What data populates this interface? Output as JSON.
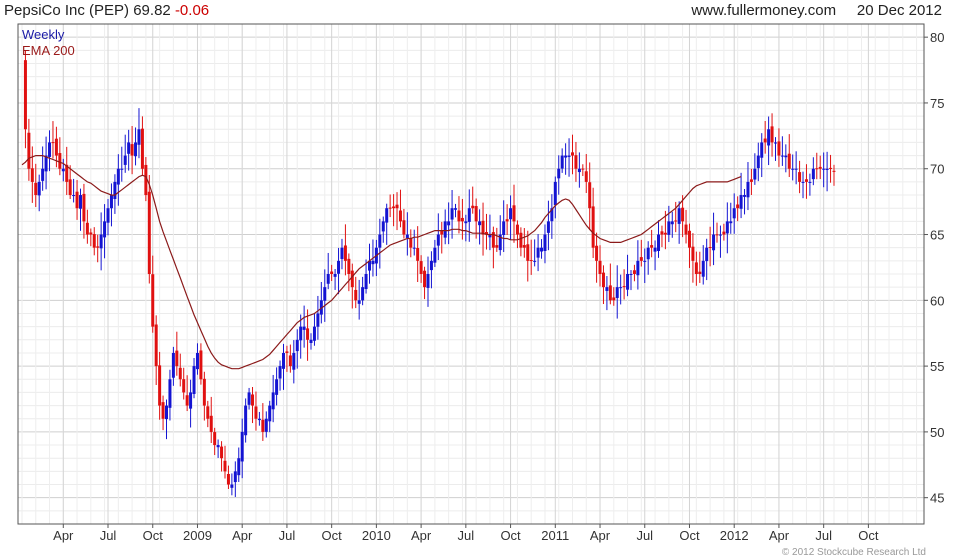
{
  "header": {
    "title": "PepsiCo Inc (PEP)",
    "last": "69.82",
    "change": "-0.06",
    "site": "www.fullermoney.com",
    "date": "20 Dec 2012"
  },
  "legend": {
    "weekly": "Weekly",
    "ema": "EMA 200"
  },
  "copyright": "© 2012 Stockcube Research Ltd",
  "colors": {
    "up": "#1414d2",
    "down": "#e01010",
    "ema": "#8b1a1a",
    "grid": "#dddddd",
    "frame": "#555555"
  },
  "chart_data": {
    "type": "candlestick",
    "period": "Weekly",
    "ylim": [
      43,
      81
    ],
    "y_ticks": [
      45,
      50,
      55,
      60,
      65,
      70,
      75,
      80
    ],
    "x_ticks": [
      "Apr",
      "Jul",
      "Oct",
      "2009",
      "Apr",
      "Jul",
      "Oct",
      "2010",
      "Apr",
      "Jul",
      "Oct",
      "2011",
      "Apr",
      "Jul",
      "Oct",
      "2012",
      "Apr",
      "Jul",
      "Oct"
    ],
    "x_tick_index": [
      12,
      25,
      38,
      51,
      64,
      77,
      90,
      103,
      116,
      129,
      142,
      155,
      168,
      181,
      194,
      207,
      220,
      233,
      246
    ],
    "x_range": [
      0,
      261
    ],
    "close_series": [
      78,
      73,
      70,
      69,
      68,
      69,
      70,
      71,
      72,
      72,
      71,
      70,
      70,
      69,
      68,
      68,
      67,
      68,
      66,
      65,
      65,
      64,
      64,
      65,
      66,
      67,
      68,
      69,
      70,
      70,
      71,
      72,
      71,
      72,
      73,
      70,
      68,
      62,
      58,
      55,
      52,
      51,
      52,
      54,
      56,
      55,
      54,
      53,
      52,
      53,
      55,
      56,
      54,
      52,
      51,
      50,
      49,
      49,
      48,
      47,
      46,
      46,
      47,
      48,
      50,
      52,
      53,
      52,
      51,
      51,
      50,
      51,
      52,
      53,
      54,
      55,
      56,
      56,
      55,
      56,
      57,
      58,
      58,
      57,
      57,
      58,
      59,
      60,
      61,
      62,
      62,
      62,
      63,
      64,
      63,
      62,
      61,
      60,
      60,
      61,
      62,
      63,
      63,
      64,
      65,
      66,
      67,
      67,
      67,
      67,
      66,
      65,
      65,
      64,
      64,
      63,
      62,
      61,
      62,
      63,
      64,
      65,
      65,
      66,
      66,
      67,
      67,
      66,
      66,
      66,
      67,
      67,
      66,
      66,
      65,
      65,
      65,
      64,
      64,
      65,
      66,
      66,
      67,
      66,
      65,
      64,
      64,
      63,
      63,
      63,
      64,
      64,
      65,
      66,
      67,
      69,
      70,
      71,
      71,
      71,
      71,
      70,
      70,
      70,
      69,
      67,
      64,
      63,
      62,
      61,
      61,
      60,
      60,
      61,
      61,
      61,
      62,
      62,
      62,
      63,
      63,
      63,
      64,
      64,
      64,
      65,
      65,
      65,
      66,
      66,
      66,
      67,
      66,
      65,
      64,
      63,
      62,
      62,
      63,
      64,
      64,
      65,
      65,
      65,
      65,
      66,
      66,
      67,
      67,
      68,
      68,
      69,
      69,
      70,
      71,
      72,
      72,
      73,
      72,
      72,
      71,
      71,
      71,
      70,
      70,
      70,
      69,
      69,
      69,
      69,
      70,
      70,
      70,
      70,
      70,
      70,
      69.82
    ],
    "ema_series": [
      70.3,
      70.5,
      70.8,
      70.9,
      71.0,
      71.0,
      71.0,
      70.9,
      70.8,
      70.7,
      70.6,
      70.5,
      70.4,
      70.2,
      70.0,
      69.8,
      69.6,
      69.4,
      69.2,
      69.0,
      68.9,
      68.7,
      68.5,
      68.3,
      68.2,
      68.1,
      68.0,
      68.0,
      68.2,
      68.4,
      68.6,
      68.8,
      69.0,
      69.2,
      69.4,
      69.5,
      69.4,
      68.8,
      68.0,
      67.0,
      66.0,
      65.2,
      64.5,
      63.8,
      63.1,
      62.4,
      61.7,
      61.0,
      60.3,
      59.6,
      58.9,
      58.3,
      57.7,
      57.1,
      56.5,
      56.0,
      55.6,
      55.3,
      55.1,
      55.0,
      54.9,
      54.8,
      54.8,
      54.8,
      54.9,
      55.0,
      55.1,
      55.2,
      55.3,
      55.4,
      55.5,
      55.7,
      55.9,
      56.2,
      56.5,
      56.8,
      57.1,
      57.4,
      57.7,
      58.0,
      58.3,
      58.5,
      58.7,
      58.8,
      58.9,
      59.0,
      59.2,
      59.4,
      59.6,
      59.8,
      60.0,
      60.3,
      60.6,
      60.9,
      61.2,
      61.5,
      61.8,
      62.1,
      62.4,
      62.6,
      62.8,
      63.0,
      63.2,
      63.4,
      63.6,
      63.8,
      64.0,
      64.2,
      64.3,
      64.4,
      64.5,
      64.6,
      64.7,
      64.7,
      64.8,
      64.8,
      64.9,
      65.0,
      65.1,
      65.2,
      65.3,
      65.3,
      65.3,
      65.3,
      65.3,
      65.4,
      65.4,
      65.4,
      65.3,
      65.3,
      65.2,
      65.1,
      65.1,
      65.1,
      65.1,
      65.0,
      65.0,
      65.0,
      64.9,
      64.8,
      64.7,
      64.7,
      64.6,
      64.6,
      64.6,
      64.7,
      64.8,
      64.9,
      65.1,
      65.3,
      65.6,
      65.9,
      66.3,
      66.6,
      66.9,
      67.2,
      67.4,
      67.6,
      67.7,
      67.6,
      67.3,
      66.9,
      66.5,
      66.1,
      65.7,
      65.4,
      65.1,
      64.9,
      64.7,
      64.6,
      64.5,
      64.4,
      64.4,
      64.4,
      64.4,
      64.5,
      64.6,
      64.7,
      64.8,
      64.9,
      65.0,
      65.2,
      65.4,
      65.6,
      65.8,
      66.0,
      66.2,
      66.4,
      66.6,
      66.8,
      67.0,
      67.3,
      67.6,
      67.9,
      68.2,
      68.5,
      68.7,
      68.8,
      68.9,
      69.0,
      69.0,
      69.0,
      69.0,
      69.0,
      69.0,
      69.0,
      69.1,
      69.2,
      69.3,
      69.4
    ]
  }
}
